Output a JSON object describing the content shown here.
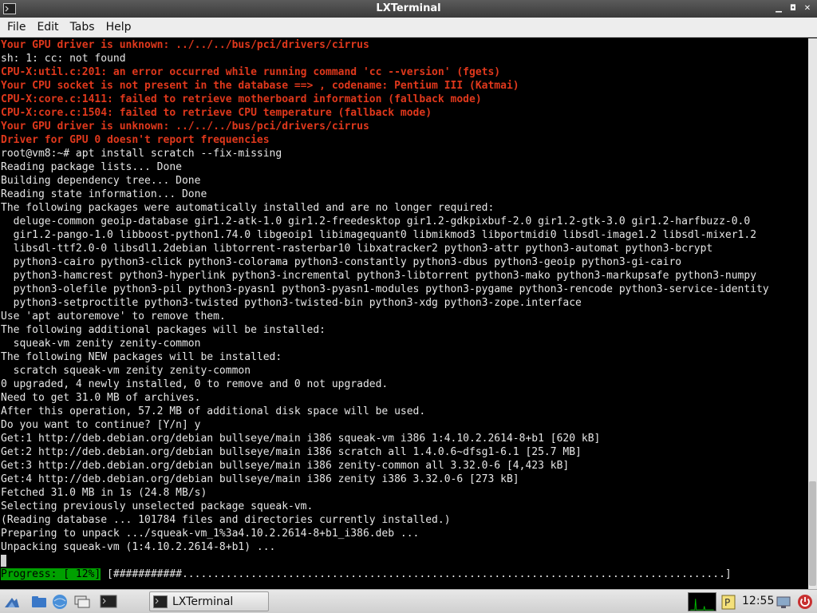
{
  "window": {
    "title": "LXTerminal",
    "minimize": "▁",
    "maximize": "◘",
    "close": "✕"
  },
  "menu": [
    "File",
    "Edit",
    "Tabs",
    "Help"
  ],
  "terminal": {
    "lines": [
      {
        "text": "Your GPU driver is unknown: ../../../bus/pci/drivers/cirrus",
        "color": "red"
      },
      {
        "text": "sh: 1: cc: not found",
        "color": "normal"
      },
      {
        "text": "CPU-X:util.c:201: an error occurred while running command 'cc --version' (fgets)",
        "color": "red"
      },
      {
        "text": "Your CPU socket is not present in the database ==> , codename: Pentium III (Katmai)",
        "color": "red"
      },
      {
        "text": "CPU-X:core.c:1411: failed to retrieve motherboard information (fallback mode)",
        "color": "red"
      },
      {
        "text": "CPU-X:core.c:1504: failed to retrieve CPU temperature (fallback mode)",
        "color": "red"
      },
      {
        "text": "Your GPU driver is unknown: ../../../bus/pci/drivers/cirrus",
        "color": "red"
      },
      {
        "text": "Driver for GPU 0 doesn't report frequencies",
        "color": "red"
      },
      {
        "text": "root@vm8:~# apt install scratch --fix-missing",
        "color": "normal"
      },
      {
        "text": "Reading package lists... Done",
        "color": "normal"
      },
      {
        "text": "Building dependency tree... Done",
        "color": "normal"
      },
      {
        "text": "Reading state information... Done",
        "color": "normal"
      },
      {
        "text": "The following packages were automatically installed and are no longer required:",
        "color": "normal"
      },
      {
        "text": "  deluge-common geoip-database gir1.2-atk-1.0 gir1.2-freedesktop gir1.2-gdkpixbuf-2.0 gir1.2-gtk-3.0 gir1.2-harfbuzz-0.0",
        "color": "normal"
      },
      {
        "text": "  gir1.2-pango-1.0 libboost-python1.74.0 libgeoip1 libimagequant0 libmikmod3 libportmidi0 libsdl-image1.2 libsdl-mixer1.2",
        "color": "normal"
      },
      {
        "text": "  libsdl-ttf2.0-0 libsdl1.2debian libtorrent-rasterbar10 libxatracker2 python3-attr python3-automat python3-bcrypt",
        "color": "normal"
      },
      {
        "text": "  python3-cairo python3-click python3-colorama python3-constantly python3-dbus python3-geoip python3-gi-cairo",
        "color": "normal"
      },
      {
        "text": "  python3-hamcrest python3-hyperlink python3-incremental python3-libtorrent python3-mako python3-markupsafe python3-numpy",
        "color": "normal"
      },
      {
        "text": "  python3-olefile python3-pil python3-pyasn1 python3-pyasn1-modules python3-pygame python3-rencode python3-service-identity",
        "color": "normal"
      },
      {
        "text": "  python3-setproctitle python3-twisted python3-twisted-bin python3-xdg python3-zope.interface",
        "color": "normal"
      },
      {
        "text": "Use 'apt autoremove' to remove them.",
        "color": "normal"
      },
      {
        "text": "The following additional packages will be installed:",
        "color": "normal"
      },
      {
        "text": "  squeak-vm zenity zenity-common",
        "color": "normal"
      },
      {
        "text": "The following NEW packages will be installed:",
        "color": "normal"
      },
      {
        "text": "  scratch squeak-vm zenity zenity-common",
        "color": "normal"
      },
      {
        "text": "0 upgraded, 4 newly installed, 0 to remove and 0 not upgraded.",
        "color": "normal"
      },
      {
        "text": "Need to get 31.0 MB of archives.",
        "color": "normal"
      },
      {
        "text": "After this operation, 57.2 MB of additional disk space will be used.",
        "color": "normal"
      },
      {
        "text": "Do you want to continue? [Y/n] y",
        "color": "normal"
      },
      {
        "text": "Get:1 http://deb.debian.org/debian bullseye/main i386 squeak-vm i386 1:4.10.2.2614-8+b1 [620 kB]",
        "color": "normal"
      },
      {
        "text": "Get:2 http://deb.debian.org/debian bullseye/main i386 scratch all 1.4.0.6~dfsg1-6.1 [25.7 MB]",
        "color": "normal"
      },
      {
        "text": "Get:3 http://deb.debian.org/debian bullseye/main i386 zenity-common all 3.32.0-6 [4,423 kB]",
        "color": "normal"
      },
      {
        "text": "Get:4 http://deb.debian.org/debian bullseye/main i386 zenity i386 3.32.0-6 [273 kB]",
        "color": "normal"
      },
      {
        "text": "Fetched 31.0 MB in 1s (24.8 MB/s)",
        "color": "normal"
      },
      {
        "text": "Selecting previously unselected package squeak-vm.",
        "color": "normal"
      },
      {
        "text": "(Reading database ... 101784 files and directories currently installed.)",
        "color": "normal"
      },
      {
        "text": "Preparing to unpack .../squeak-vm_1%3a4.10.2.2614-8+b1_i386.deb ...",
        "color": "normal"
      },
      {
        "text": "Unpacking squeak-vm (1:4.10.2.2614-8+b1) ...",
        "color": "normal"
      }
    ],
    "progress_label": "Progress: [ 12%]",
    "progress_bar": " [###########.......................................................................................]",
    "colors": {
      "red": "#e0381c",
      "text": "#e6e6e6",
      "progress_bg": "#00a000"
    }
  },
  "taskbar": {
    "task_label": "LXTerminal",
    "clock": "12:55",
    "icons": [
      "start-menu-icon",
      "file-manager-icon",
      "browser-icon",
      "show-desktop-icon",
      "terminal-launcher-icon",
      "cpu-monitor",
      "power-icon"
    ]
  }
}
